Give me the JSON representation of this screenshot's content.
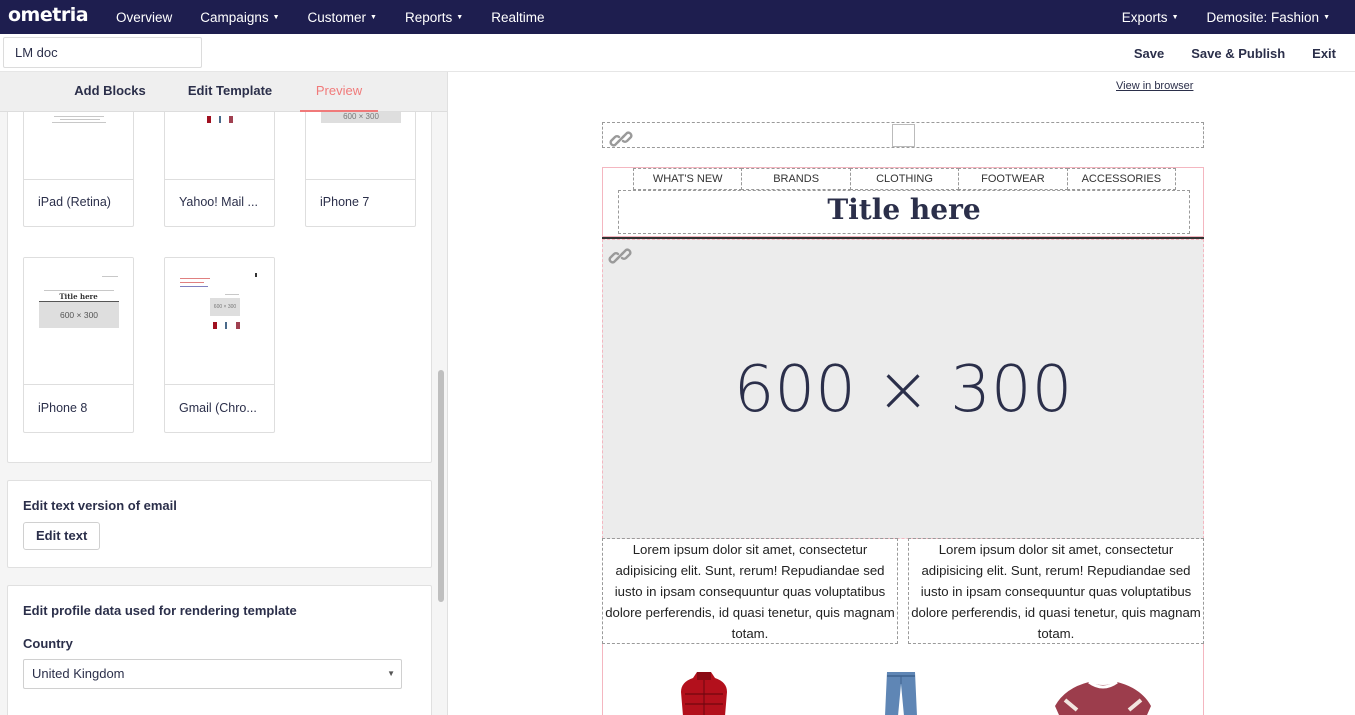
{
  "topnav": {
    "logo": "ometria",
    "items": [
      {
        "label": "Overview",
        "caret": false
      },
      {
        "label": "Campaigns",
        "caret": true
      },
      {
        "label": "Customer",
        "caret": true
      },
      {
        "label": "Reports",
        "caret": true
      },
      {
        "label": "Realtime",
        "caret": false
      }
    ],
    "right": [
      {
        "label": "Exports",
        "caret": true
      },
      {
        "label": "Demosite: Fashion",
        "caret": true
      }
    ]
  },
  "docbar": {
    "name_value": "LM doc",
    "actions": {
      "save": "Save",
      "save_publish": "Save & Publish",
      "exit": "Exit"
    }
  },
  "tabs": {
    "add_blocks": "Add Blocks",
    "edit_template": "Edit Template",
    "preview": "Preview"
  },
  "devices": [
    {
      "label": "iPad (Retina)"
    },
    {
      "label": "Yahoo! Mail ...",
      "swatch_colors": [
        "#a01020",
        "#4a6a8a",
        "#a04050"
      ]
    },
    {
      "label": "iPhone 7",
      "thumb_text": "600 × 300"
    },
    {
      "label": "iPhone 8",
      "thumb_title": "Title here",
      "thumb_text": "600 × 300"
    },
    {
      "label": "Gmail (Chro...",
      "thumb_text": "600 × 300",
      "swatch_colors": [
        "#a01020",
        "#4a6a8a",
        "#a04050"
      ]
    }
  ],
  "text_version": {
    "title": "Edit text version of email",
    "button": "Edit text"
  },
  "profile": {
    "title": "Edit profile data used for rendering template",
    "country_label": "Country",
    "country_value": "United Kingdom"
  },
  "email_preview": {
    "view_in_browser": "View in browser",
    "nav_links": [
      "WHAT'S NEW",
      "BRANDS",
      "CLOTHING",
      "FOOTWEAR",
      "ACCESSORIES"
    ],
    "title": "Title here",
    "hero_text": "600 × 300",
    "lorem_left": "Lorem ipsum dolor sit amet, consectetur adipisicing elit. Sunt, rerum! Repudiandae sed iusto in ipsam consequuntur quas voluptatibus dolore perferendis, id quasi tenetur, quis magnam totam.",
    "lorem_right": "Lorem ipsum dolor sit amet, consectetur adipisicing elit. Sunt, rerum! Repudiandae sed iusto in ipsam consequuntur quas voluptatibus dolore perferendis, id quasi tenetur, quis magnam totam.",
    "products": [
      "red-puffer-vest",
      "blue-jeans",
      "red-sports-shirt"
    ]
  },
  "colors": {
    "nav_bg": "#1e1e4f",
    "accent": "#f07a7a",
    "hero_bg": "#ececec"
  }
}
